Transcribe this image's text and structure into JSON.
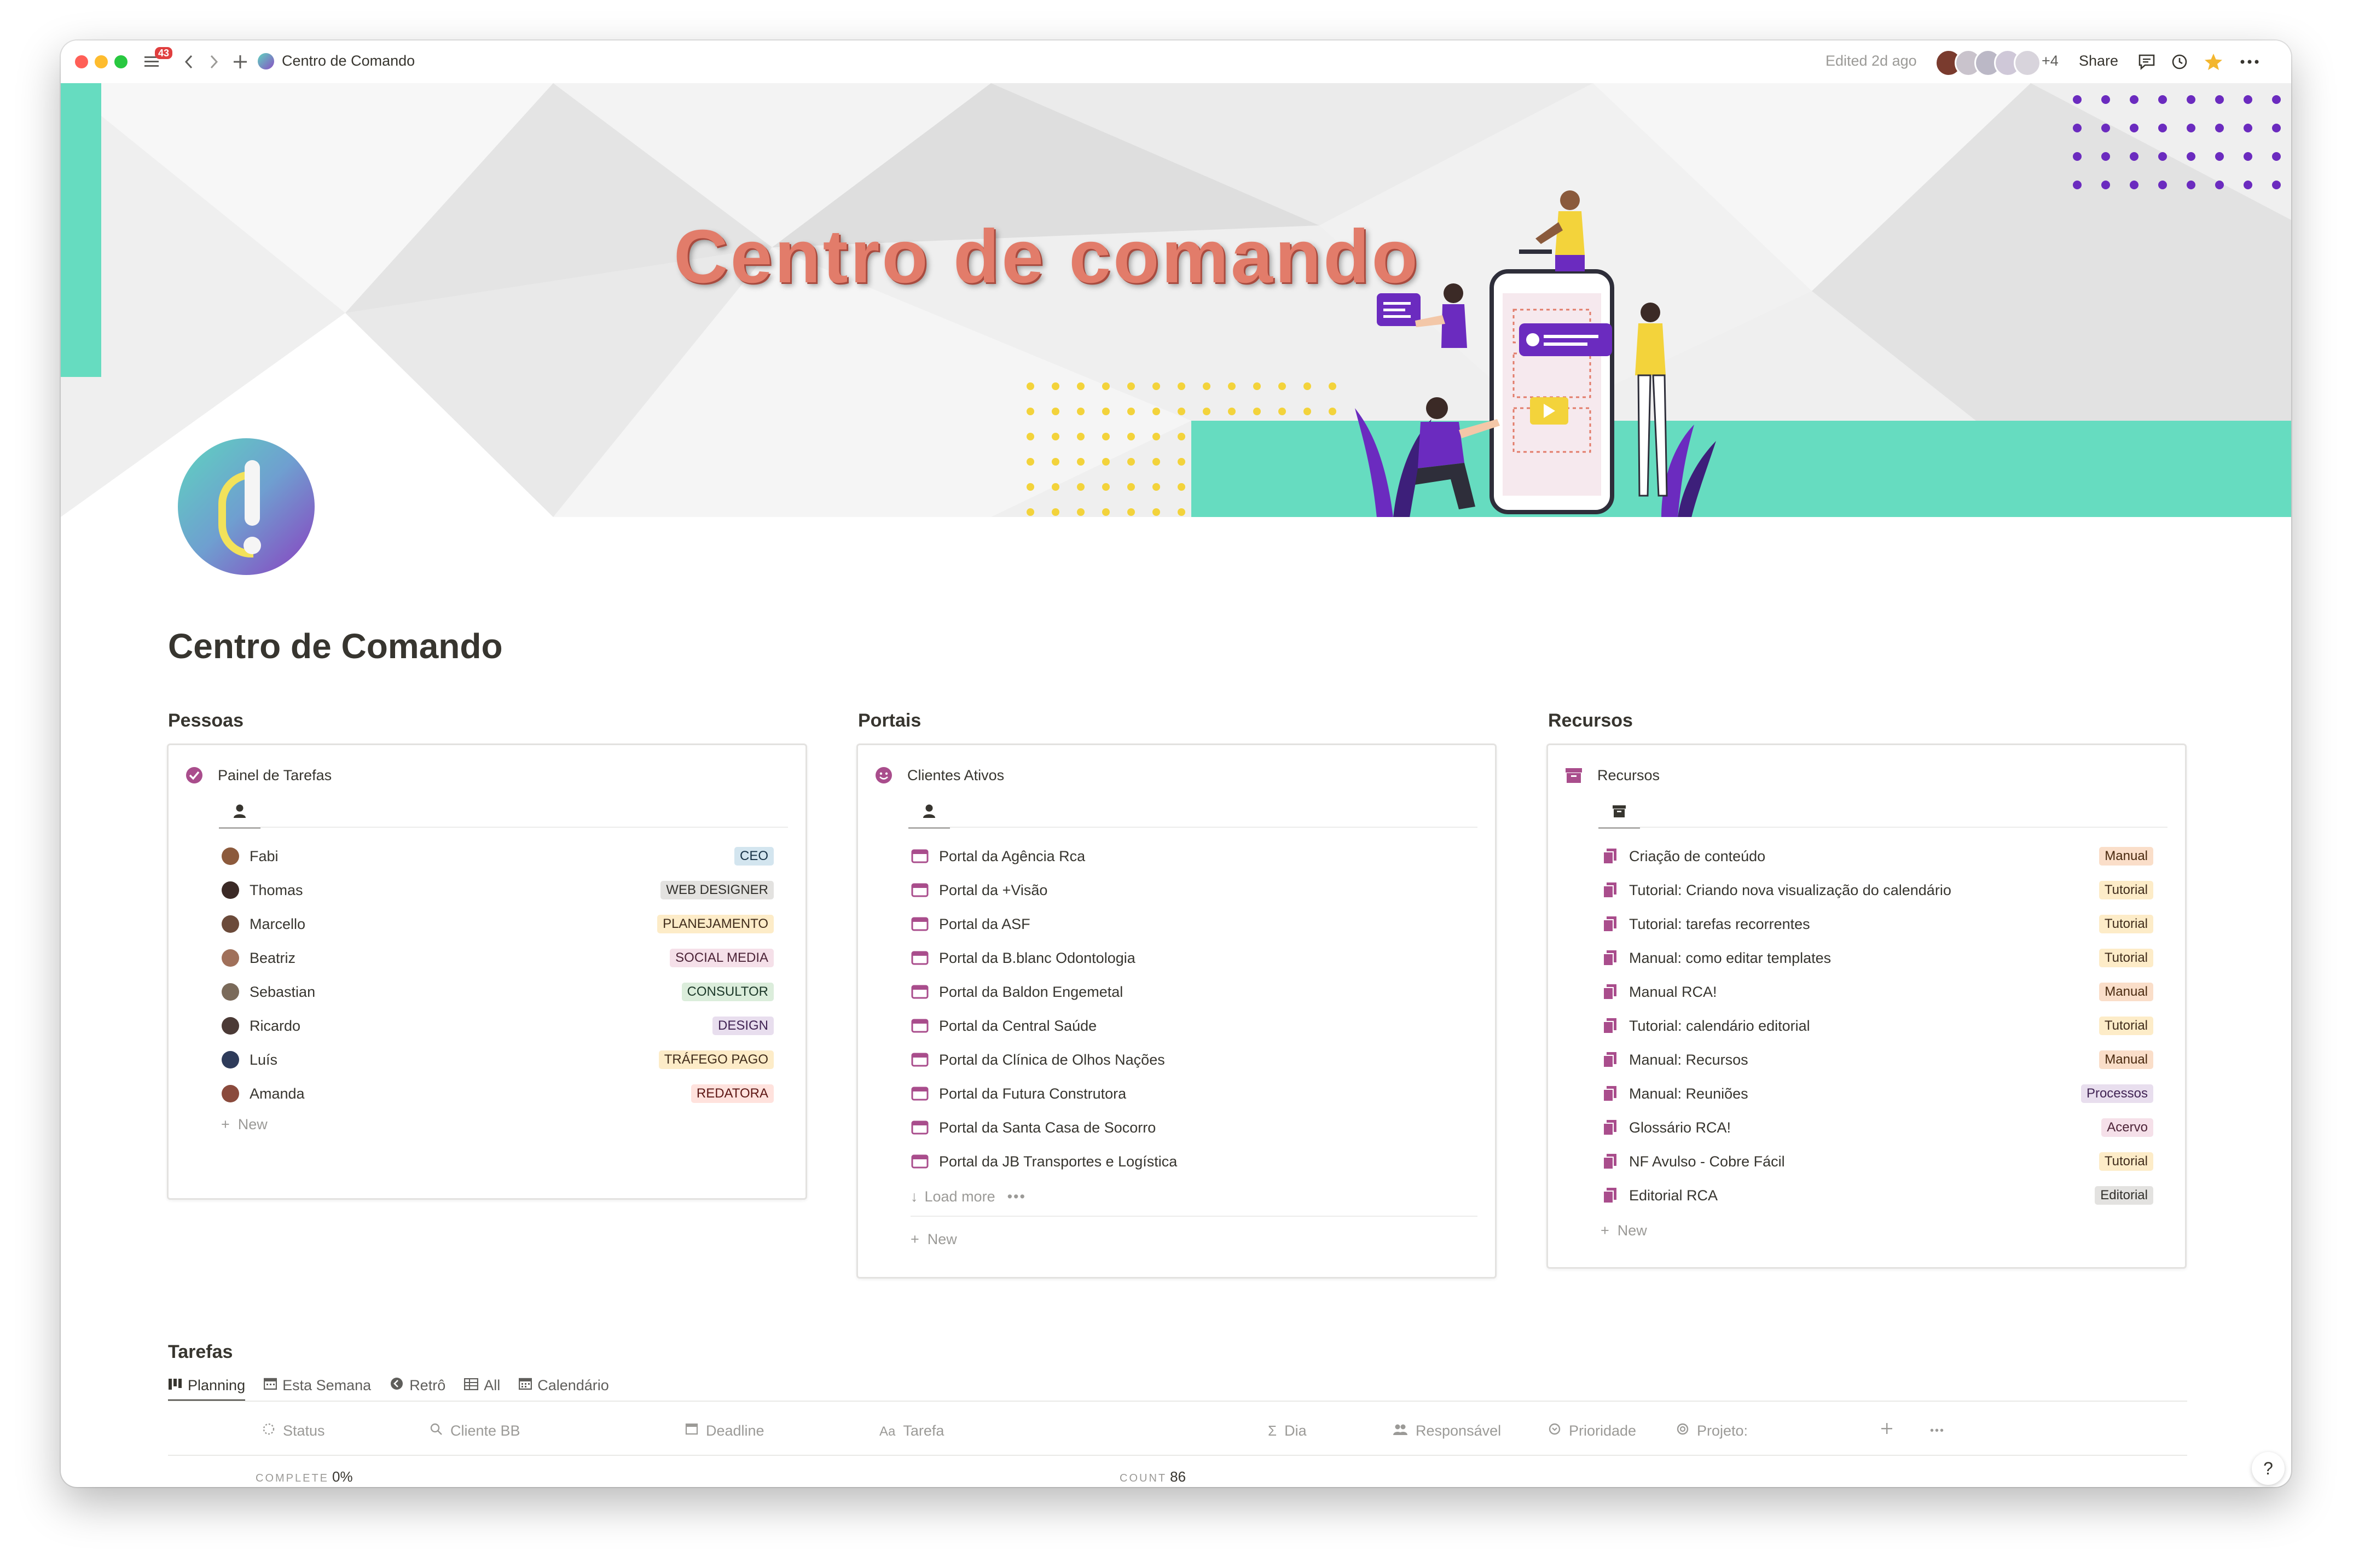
{
  "titlebar": {
    "badge_count": "43",
    "breadcrumb": "Centro de Comando",
    "edited": "Edited 2d ago",
    "more_collaborators": "+4",
    "share": "Share"
  },
  "cover": {
    "title": "Centro de comando",
    "colors": {
      "teal": "#66dcc0",
      "purple": "#6b2bbf",
      "yellow": "#f3d33b",
      "title": "#e27c6a"
    }
  },
  "page": {
    "title": "Centro de Comando"
  },
  "pessoas": {
    "header": "Pessoas",
    "view_title": "Painel de Tarefas",
    "new_label": "New",
    "people": [
      {
        "name": "Fabi",
        "role": "CEO",
        "tag_bg": "#d3e5ef",
        "tag_fg": "#183347"
      },
      {
        "name": "Thomas",
        "role": "WEB DESIGNER",
        "tag_bg": "#e3e2e0",
        "tag_fg": "#32302c"
      },
      {
        "name": "Marcello",
        "role": "PLANEJAMENTO",
        "tag_bg": "#fdecc8",
        "tag_fg": "#402c1b"
      },
      {
        "name": "Beatriz",
        "role": "SOCIAL MEDIA",
        "tag_bg": "#f5e0e9",
        "tag_fg": "#4c2337"
      },
      {
        "name": "Sebastian",
        "role": "CONSULTOR",
        "tag_bg": "#dbeddb",
        "tag_fg": "#1c3829"
      },
      {
        "name": "Ricardo",
        "role": "DESIGN",
        "tag_bg": "#e8deee",
        "tag_fg": "#412454"
      },
      {
        "name": "Luís",
        "role": "TRÁFEGO PAGO",
        "tag_bg": "#fdecc8",
        "tag_fg": "#402c1b"
      },
      {
        "name": "Amanda",
        "role": "REDATORA",
        "tag_bg": "#ffe2dd",
        "tag_fg": "#5d1715"
      }
    ]
  },
  "portais": {
    "header": "Portais",
    "view_title": "Clientes Ativos",
    "load_more": "Load more",
    "new_label": "New",
    "items": [
      "Portal da Agência Rca",
      "Portal da +Visão",
      "Portal da ASF",
      "Portal da B.blanc Odontologia",
      "Portal da Baldon Engemetal",
      "Portal da Central Saúde",
      "Portal da Clínica de Olhos Nações",
      "Portal da Futura Construtora",
      "Portal da Santa Casa de Socorro",
      "Portal da JB Transportes e Logística"
    ]
  },
  "recursos": {
    "header": "Recursos",
    "view_title": "Recursos",
    "new_label": "New",
    "items": [
      {
        "title": "Criação de conteúdo",
        "tag": "Manual",
        "tag_bg": "#fadec9",
        "tag_fg": "#49290e"
      },
      {
        "title": "Tutorial: Criando nova visualização do calendário",
        "tag": "Tutorial",
        "tag_bg": "#fdecc8",
        "tag_fg": "#402c1b"
      },
      {
        "title": "Tutorial: tarefas recorrentes",
        "tag": "Tutorial",
        "tag_bg": "#fdecc8",
        "tag_fg": "#402c1b"
      },
      {
        "title": "Manual: como editar templates",
        "tag": "Tutorial",
        "tag_bg": "#fdecc8",
        "tag_fg": "#402c1b"
      },
      {
        "title": "Manual RCA!",
        "tag": "Manual",
        "tag_bg": "#fadec9",
        "tag_fg": "#49290e"
      },
      {
        "title": "Tutorial: calendário editorial",
        "tag": "Tutorial",
        "tag_bg": "#fdecc8",
        "tag_fg": "#402c1b"
      },
      {
        "title": "Manual: Recursos",
        "tag": "Manual",
        "tag_bg": "#fadec9",
        "tag_fg": "#49290e"
      },
      {
        "title": "Manual: Reuniões",
        "tag": "Processos",
        "tag_bg": "#e8deee",
        "tag_fg": "#412454"
      },
      {
        "title": "Glossário RCA!",
        "tag": "Acervo",
        "tag_bg": "#f5e0e9",
        "tag_fg": "#4c2337"
      },
      {
        "title": "NF Avulso - Cobre Fácil",
        "tag": "Tutorial",
        "tag_bg": "#fdecc8",
        "tag_fg": "#402c1b"
      },
      {
        "title": "Editorial RCA",
        "tag": "Editorial",
        "tag_bg": "#e3e2e0",
        "tag_fg": "#32302c"
      }
    ]
  },
  "tarefas": {
    "header": "Tarefas",
    "tabs": [
      {
        "label": "Planning",
        "icon": "board-icon",
        "active": true
      },
      {
        "label": "Esta Semana",
        "icon": "calendar-grid-icon"
      },
      {
        "label": "Retrô",
        "icon": "back-circle-icon"
      },
      {
        "label": "All",
        "icon": "table-icon"
      },
      {
        "label": "Calendário",
        "icon": "calendar-icon"
      }
    ],
    "columns": [
      {
        "label": "Status",
        "icon": "status-icon"
      },
      {
        "label": "Cliente BB",
        "icon": "search-icon"
      },
      {
        "label": "Deadline",
        "icon": "date-icon"
      },
      {
        "label": "Tarefa",
        "icon": "text-icon"
      },
      {
        "label": "Dia",
        "icon": "formula-icon"
      },
      {
        "label": "Responsável",
        "icon": "people-icon"
      },
      {
        "label": "Prioridade",
        "icon": "select-icon"
      },
      {
        "label": "Projeto:",
        "icon": "rollup-icon"
      }
    ],
    "complete_label": "COMPLETE",
    "complete_value": "0%",
    "count_label": "COUNT",
    "count_value": "86"
  },
  "help": "?"
}
